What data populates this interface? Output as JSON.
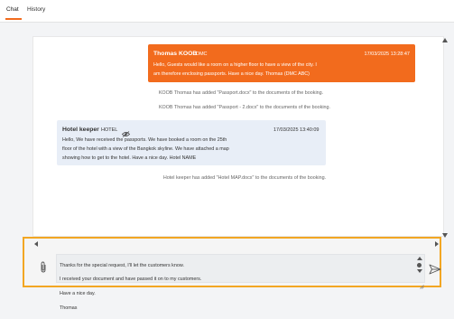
{
  "tabs": [
    {
      "label": "Chat",
      "active": true
    },
    {
      "label": "History",
      "active": false
    }
  ],
  "colors": {
    "accent": "#f26b1d",
    "highlight_border": "#f2a623",
    "hotel_bubble": "#e8eef7"
  },
  "messages": [
    {
      "sender": "Thomas KOOB",
      "role": "DMC",
      "time": "17/03/2025 13:28:47",
      "lines": [
        "Hello, Guests would like a room on a higher floor to have a view of the city. I",
        "am therefore enclosing passports. Have a nice day. Thomas (DMC ABC)"
      ]
    },
    {
      "sender": "Hotel keeper",
      "role": "HOTEL",
      "icon": "eye-slash-icon",
      "time": "17/03/2025 13:40:09",
      "lines": [
        "Hello, We have received the passports. We have booked a room on the 25th",
        "floor of the hotel with a view of the Bangkok skyline. We have attached a map",
        "showing how to get to the hotel. Have a nice day. Hotel NAME"
      ]
    }
  ],
  "notices": [
    "KOOB Thomas has added \"Passport.docx\" to the documents of the booking.",
    "KOOB Thomas has added \"Passport - 2.docx\" to the documents of the booking.",
    "Hotel keeper has added \"Hotel MAP.docx\" to the documents of the booking."
  ],
  "composer": {
    "lines": [
      "Thanks for the special request, I'll let the customers know.",
      "I received your document and have passed it on to my customers.",
      "Have a nice day.",
      "Thomas"
    ],
    "attach_icon": "paperclip-icon",
    "send_icon": "send-icon"
  }
}
